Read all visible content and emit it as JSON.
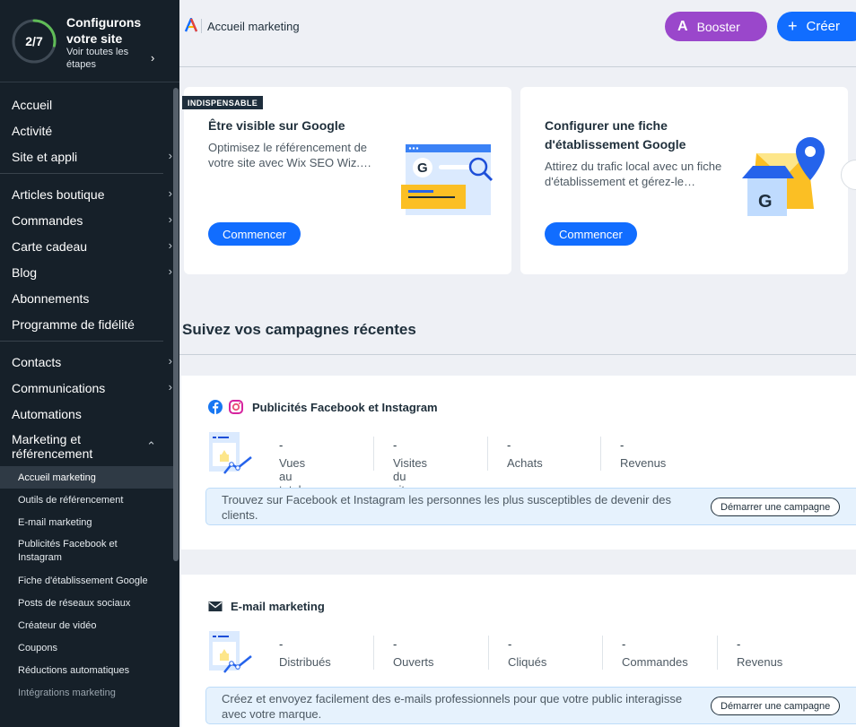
{
  "setup": {
    "progress": "2/7",
    "title": "Configurons votre site",
    "link": "Voir toutes les étapes",
    "progress_fraction": 0.2857
  },
  "sidebar": {
    "group1": [
      {
        "label": "Accueil"
      },
      {
        "label": "Activité"
      },
      {
        "label": "Site et appli",
        "chevron": true
      }
    ],
    "group2": [
      {
        "label": "Articles boutique",
        "chevron": true
      },
      {
        "label": "Commandes",
        "chevron": true
      },
      {
        "label": "Carte cadeau",
        "chevron": true
      },
      {
        "label": "Blog",
        "chevron": true
      },
      {
        "label": "Abonnements"
      },
      {
        "label": "Programme de fidélité"
      }
    ],
    "group3": [
      {
        "label": "Contacts",
        "chevron": true
      },
      {
        "label": "Communications",
        "chevron": true
      },
      {
        "label": "Automations"
      }
    ],
    "marketing": {
      "label": "Marketing et référencement"
    },
    "sub": [
      {
        "label": "Accueil marketing",
        "active": true
      },
      {
        "label": "Outils de référencement"
      },
      {
        "label": "E-mail marketing"
      },
      {
        "label": "Publicités Facebook et Instagram"
      },
      {
        "label": "Fiche d'établissement Google"
      },
      {
        "label": "Posts de réseaux sociaux"
      },
      {
        "label": "Créateur de vidéo"
      },
      {
        "label": "Coupons"
      },
      {
        "label": "Réductions automatiques"
      },
      {
        "label": "Intégrations marketing"
      }
    ]
  },
  "topbar": {
    "title": "Accueil marketing",
    "booster": "Booster",
    "create": "Créer"
  },
  "cards": [
    {
      "badge": "INDISPENSABLE",
      "title": "Être visible sur Google",
      "desc": "Optimisez le référencement de votre site avec Wix SEO Wiz.…",
      "button": "Commencer"
    },
    {
      "title": "Configurer une fiche d'établissement Google",
      "desc": "Attirez du trafic local avec un fiche d'établissement et gérez-le…",
      "button": "Commencer"
    }
  ],
  "section_title": "Suivez vos campagnes récentes",
  "campaigns": [
    {
      "title": "Publicités Facebook et Instagram",
      "metrics": [
        {
          "value": "-",
          "label": "Vues au total"
        },
        {
          "value": "-",
          "label": "Visites du site"
        },
        {
          "value": "-",
          "label": "Achats"
        },
        {
          "value": "-",
          "label": "Revenus"
        }
      ],
      "info": "Trouvez sur Facebook et Instagram les personnes les plus susceptibles de devenir des clients.",
      "button": "Démarrer une campagne"
    },
    {
      "title": "E-mail marketing",
      "metrics": [
        {
          "value": "-",
          "label": "Distribués"
        },
        {
          "value": "-",
          "label": "Ouverts"
        },
        {
          "value": "-",
          "label": "Cliqués"
        },
        {
          "value": "-",
          "label": "Commandes"
        },
        {
          "value": "-",
          "label": "Revenus"
        }
      ],
      "info": "Créez et envoyez facilement des e-mails professionnels pour que votre public interagisse avec votre marque.",
      "button": "Démarrer une campagne"
    }
  ],
  "colors": {
    "sidebar": "#162029",
    "accent": "#116dff",
    "booster": "#9a47cb",
    "progress": "#60bc57"
  }
}
